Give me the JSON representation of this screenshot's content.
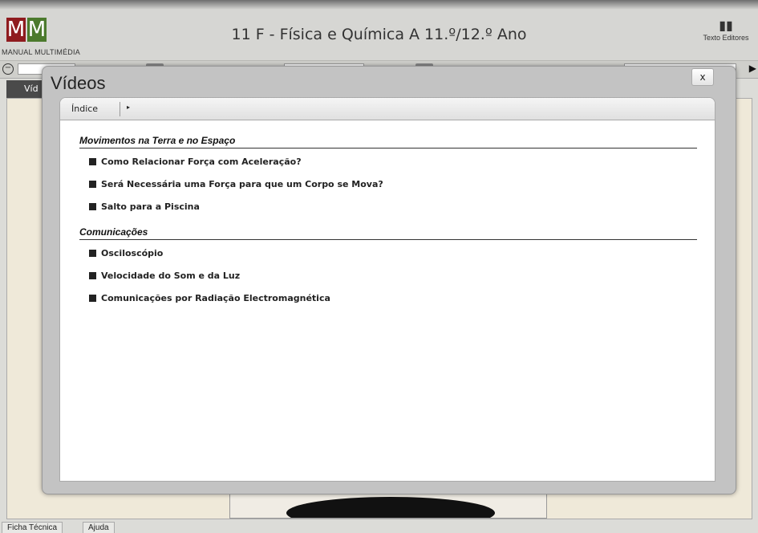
{
  "header": {
    "logo_letters": [
      "M",
      "M"
    ],
    "brand_subtitle": "MANUAL MULTIMÉDIA",
    "title": "11 F - Física e Química A 11.º/12.º Ano",
    "publisher": "Texto Editores",
    "publisher_icon": "book-icon"
  },
  "toolbar": {
    "zoom_icon": "zoom-out-icon",
    "next_icon": "play-arrow-icon"
  },
  "tab_behind": {
    "label": "Víd"
  },
  "modal": {
    "title": "Vídeos",
    "close_label": "x",
    "nav": {
      "index_label": "Índice",
      "arrow": "▸"
    },
    "sections": [
      {
        "heading": "Movimentos na Terra e no Espaço",
        "items": [
          "Como Relacionar Força com Aceleração?",
          "Será Necessária uma Força para que um Corpo se Mova?",
          "Salto para a Piscina"
        ]
      },
      {
        "heading": "Comunicações",
        "items": [
          "Osciloscópio",
          "Velocidade do Som e da Luz",
          "Comunicações por Radiação Electromagnética"
        ]
      }
    ]
  },
  "footer": {
    "tabs": [
      "Ficha Técnica",
      "Ajuda"
    ]
  },
  "colors": {
    "logo_red": "#8f1b1f",
    "logo_green": "#4c7a2d"
  }
}
